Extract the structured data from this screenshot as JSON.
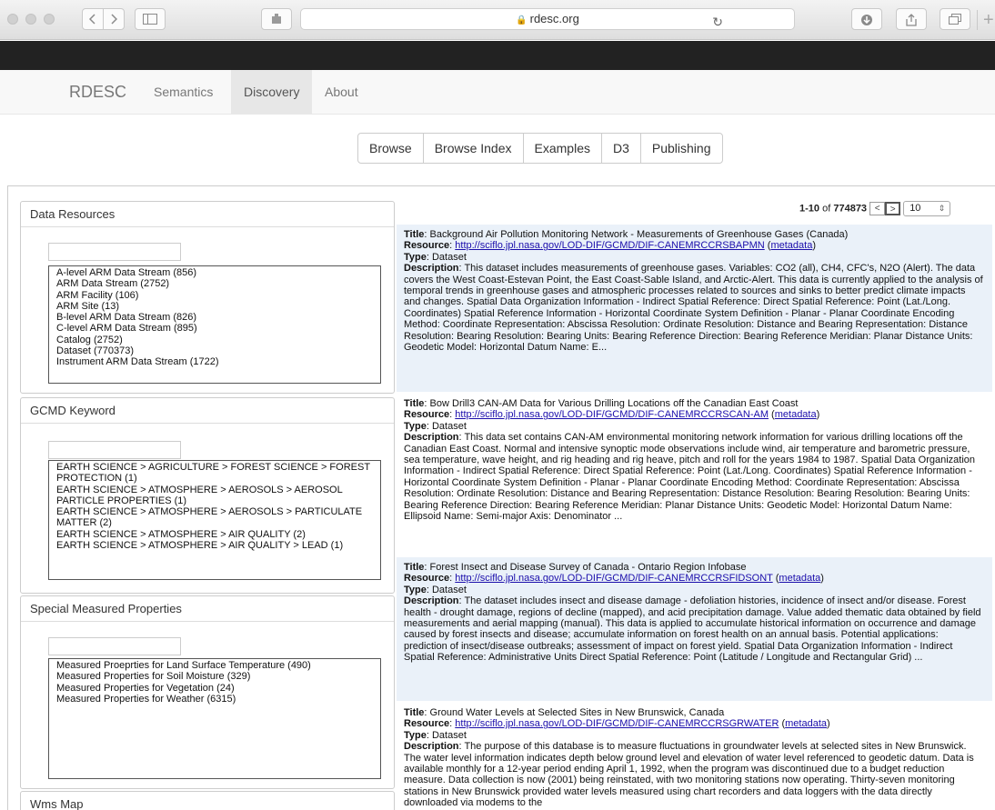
{
  "browser": {
    "url": "rdesc.org"
  },
  "nav": {
    "brand": "RDESC",
    "links": [
      "Semantics",
      "Discovery",
      "About"
    ]
  },
  "buttons": [
    "Browse",
    "Browse Index",
    "Examples",
    "D3",
    "Publishing"
  ],
  "pager": {
    "range": "1-10",
    "of": "of",
    "total": "774873",
    "prev": "<",
    "next": ">",
    "per_page": "10"
  },
  "facets": [
    {
      "title": "Data Resources",
      "items": [
        "A-level ARM Data Stream (856)",
        "ARM Data Stream (2752)",
        "ARM Facility (106)",
        "ARM Site (13)",
        "B-level ARM Data Stream (826)",
        "C-level ARM Data Stream (895)",
        "Catalog (2752)",
        "Dataset (770373)",
        "Instrument ARM Data Stream (1722)"
      ]
    },
    {
      "title": "GCMD Keyword",
      "items": [
        "EARTH SCIENCE > AGRICULTURE > FOREST SCIENCE > FOREST PROTECTION (1)",
        "EARTH SCIENCE > ATMOSPHERE > AEROSOLS > AEROSOL PARTICLE PROPERTIES (1)",
        "EARTH SCIENCE > ATMOSPHERE > AEROSOLS > PARTICULATE MATTER (2)",
        "EARTH SCIENCE > ATMOSPHERE > AIR QUALITY (2)",
        "EARTH SCIENCE > ATMOSPHERE > AIR QUALITY > LEAD (1)"
      ]
    },
    {
      "title": "Special Measured Properties",
      "items": [
        "Measured Proeprties for Land Surface Temperature (490)",
        "Measured Properties for Soil Moisture (329)",
        "Measured Properties for Vegetation (24)",
        "Measured Properties for Weather (6315)"
      ]
    },
    {
      "title": "Wms Map",
      "items": []
    }
  ],
  "labels": {
    "title": "Title",
    "resource": "Resource",
    "type": "Type",
    "description": "Description",
    "metadata": "metadata"
  },
  "results": [
    {
      "title": "Background Air Pollution Monitoring Network - Measurements of Greenhouse Gases (Canada)",
      "resource": "http://sciflo.jpl.nasa.gov/LOD-DIF/GCMD/DIF-CANEMRCCRSBAPMN",
      "type": "Dataset",
      "description": "This dataset includes measurements of greenhouse gases. Variables: CO2 (all), CH4, CFC's, N2O (Alert). The data covers the West Coast-Estevan Point, the East Coast-Sable Island, and Arctic-Alert. This data is currently applied to the analysis of temporal trends in greenhouse gases and atmospheric processes related to sources and sinks to better predict climate impacts and changes. Spatial Data Organization Information - Indirect Spatial Reference: Direct Spatial Reference: Point (Lat./Long. Coordinates) Spatial Reference Information - Horizontal Coordinate System Definition - Planar - Planar Coordinate Encoding Method: Coordinate Representation: Abscissa Resolution: Ordinate Resolution: Distance and Bearing Representation: Distance Resolution: Bearing Resolution: Bearing Units: Bearing Reference Direction: Bearing Reference Meridian: Planar Distance Units: Geodetic Model: Horizontal Datum Name: E..."
    },
    {
      "title": "Bow Drill3 CAN-AM Data for Various Drilling Locations off the Canadian East Coast",
      "resource": "http://sciflo.jpl.nasa.gov/LOD-DIF/GCMD/DIF-CANEMRCCRSCAN-AM",
      "type": "Dataset",
      "description": "This data set contains CAN-AM environmental monitoring network information for various drilling locations off the Canadian East Coast. Normal and intensive synoptic mode observations include wind, air temperature and barometric pressure, sea temperature, wave height, and rig heading and rig heave, pitch and roll for the years 1984 to 1987. Spatial Data Organization Information - Indirect Spatial Reference: Direct Spatial Reference: Point (Lat./Long. Coordinates) Spatial Reference Information - Horizontal Coordinate System Definition - Planar - Planar Coordinate Encoding Method: Coordinate Representation: Abscissa Resolution: Ordinate Resolution: Distance and Bearing Representation: Distance Resolution: Bearing Resolution: Bearing Units: Bearing Reference Direction: Bearing Reference Meridian: Planar Distance Units: Geodetic Model: Horizontal Datum Name: Ellipsoid Name: Semi-major Axis: Denominator ..."
    },
    {
      "title": "Forest Insect and Disease Survey of Canada - Ontario Region Infobase",
      "resource": "http://sciflo.jpl.nasa.gov/LOD-DIF/GCMD/DIF-CANEMRCCRSFIDSONT",
      "type": "Dataset",
      "description": "The dataset includes insect and disease damage - defoliation histories, incidence of insect and/or disease. Forest health - drought damage, regions of decline (mapped), and acid precipitation damage. Value added thematic data obtained by field measurements and aerial mapping (manual). This data is applied to accumulate historical information on occurrence and damage caused by forest insects and disease; accumulate information on forest health on an annual basis. Potential applications: prediction of insect/disease outbreaks; assessment of impact on forest yield. Spatial Data Organization Information - Indirect Spatial Reference: Administrative Units Direct Spatial Reference: Point (Latitude / Longitude and Rectangular Grid) ..."
    },
    {
      "title": "Ground Water Levels at Selected Sites in New Brunswick, Canada",
      "resource": "http://sciflo.jpl.nasa.gov/LOD-DIF/GCMD/DIF-CANEMRCCRSGRWATER",
      "type": "Dataset",
      "description": "The purpose of this database is to measure fluctuations in groundwater levels at selected sites in New Brunswick. The water level information indicates depth below ground level and elevation of water level referenced to geodetic datum. Data is available monthly for a 12-year period ending April 1, 1992, when the program was discontinued due to a budget reduction measure. Data collection is now (2001) being reinstated, with two monitoring stations now operating. Thirty-seven monitoring stations in New Brunswick provided water levels measured using chart recorders and data loggers with the data directly downloaded via modems to the"
    }
  ]
}
